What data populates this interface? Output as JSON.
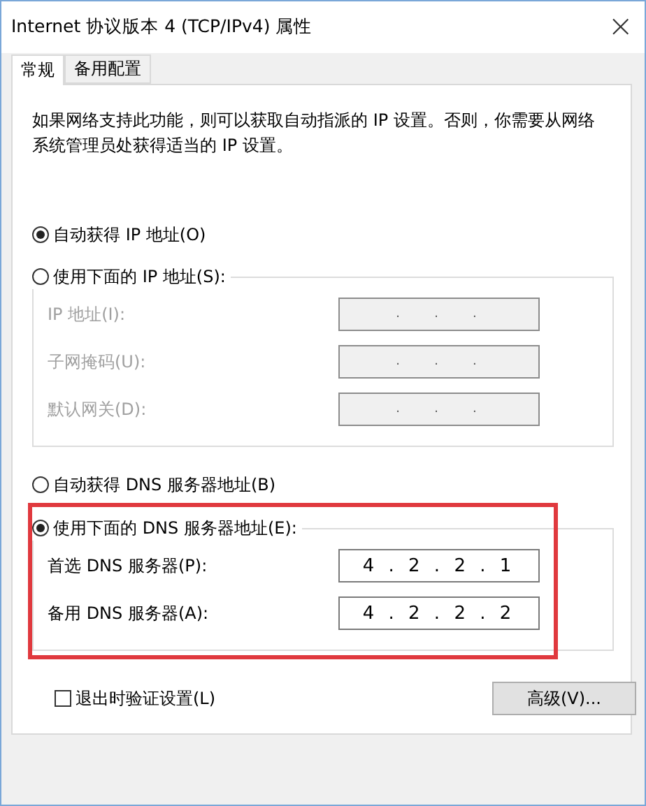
{
  "window": {
    "title": "Internet 协议版本 4 (TCP/IPv4) 属性",
    "close": "×"
  },
  "tabs": [
    {
      "label": "常规",
      "selected": true
    },
    {
      "label": "备用配置",
      "selected": false
    }
  ],
  "description": "如果网络支持此功能，则可以获取自动指派的 IP 设置。否则，你需要从网络系统管理员处获得适当的 IP 设置。",
  "ip_mode": [
    {
      "label": "自动获得 IP 地址(O)",
      "selected": true
    },
    {
      "label": "使用下面的 IP 地址(S):",
      "selected": false
    }
  ],
  "ip_fields": [
    {
      "label": "IP 地址(I):",
      "value": ".   .   .",
      "disabled": true
    },
    {
      "label": "子网掩码(U):",
      "value": ".   .   .",
      "disabled": true
    },
    {
      "label": "默认网关(D):",
      "value": ".   .   .",
      "disabled": true
    }
  ],
  "dns_mode": [
    {
      "label": "自动获得 DNS 服务器地址(B)",
      "selected": false
    },
    {
      "label": "使用下面的 DNS 服务器地址(E):",
      "selected": true
    }
  ],
  "dns_fields": [
    {
      "label": "首选 DNS 服务器(P):",
      "value": "4 . 2 . 2 . 1",
      "disabled": false
    },
    {
      "label": "备用 DNS 服务器(A):",
      "value": "4 . 2 . 2 . 2",
      "disabled": false
    }
  ],
  "validate": {
    "label": "退出时验证设置(L)",
    "checked": false
  },
  "advanced_button": "高级(V)..."
}
